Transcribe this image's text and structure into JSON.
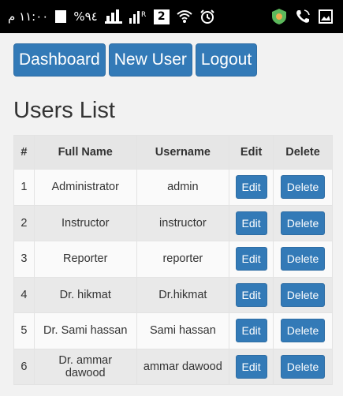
{
  "status_bar": {
    "time": "١١:٠٠ م",
    "battery_percent": "%٩٤",
    "sim_label": "2"
  },
  "nav": {
    "dashboard": "Dashboard",
    "new_user": "New User",
    "logout": "Logout"
  },
  "page_title": "Users List",
  "table": {
    "headers": [
      "#",
      "Full Name",
      "Username",
      "Edit",
      "Delete"
    ],
    "rows": [
      {
        "num": "1",
        "full_name": "Administrator",
        "username": "admin",
        "edit": "Edit",
        "delete": "Delete"
      },
      {
        "num": "2",
        "full_name": "Instructor",
        "username": "instructor",
        "edit": "Edit",
        "delete": "Delete"
      },
      {
        "num": "3",
        "full_name": "Reporter",
        "username": "reporter",
        "edit": "Edit",
        "delete": "Delete"
      },
      {
        "num": "4",
        "full_name": "Dr. hikmat",
        "username": "Dr.hikmat",
        "edit": "Edit",
        "delete": "Delete"
      },
      {
        "num": "5",
        "full_name": "Dr. Sami hassan",
        "username": "Sami hassan",
        "edit": "Edit",
        "delete": "Delete"
      },
      {
        "num": "6",
        "full_name": "Dr. ammar dawood",
        "username": "ammar dawood",
        "edit": "Edit",
        "delete": "Delete"
      }
    ]
  },
  "colors": {
    "primary": "#337ab7",
    "primary_border": "#2e6da4",
    "status_bar": "#000000",
    "page_background": "#f2f2f2"
  },
  "icons": [
    "battery-icon",
    "signal-bars-icon",
    "signal-bars-roaming-icon",
    "sim-icon",
    "wifi-icon",
    "alarm-icon",
    "app-shield-icon",
    "phone-call-icon",
    "gallery-icon"
  ]
}
